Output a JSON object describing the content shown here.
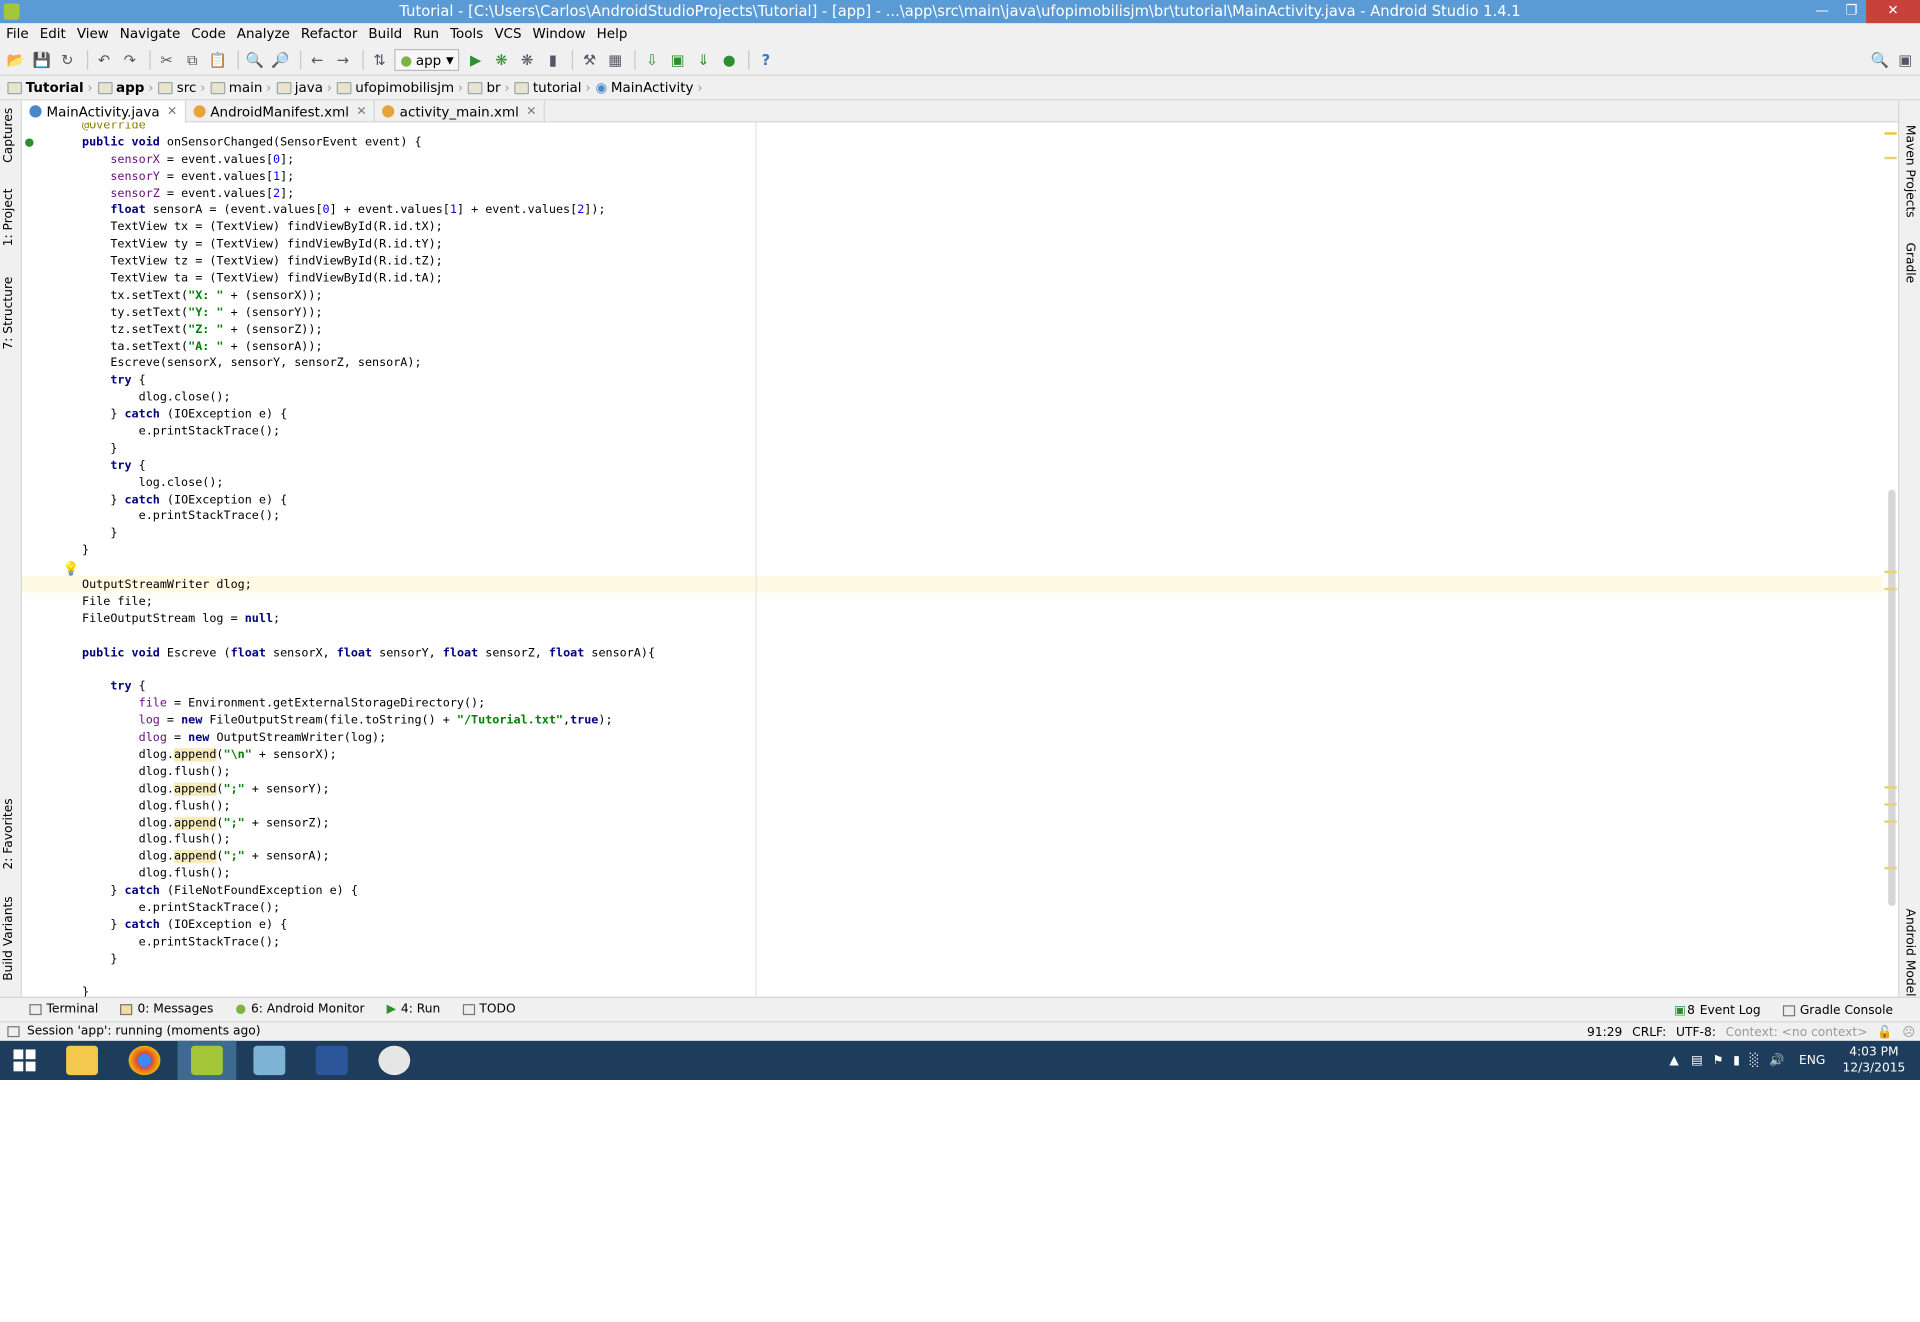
{
  "window": {
    "title": "Tutorial - [C:\\Users\\Carlos\\AndroidStudioProjects\\Tutorial] - [app] - ...\\app\\src\\main\\java\\ufopimobilisjm\\br\\tutorial\\MainActivity.java - Android Studio 1.4.1"
  },
  "menu": [
    "File",
    "Edit",
    "View",
    "Navigate",
    "Code",
    "Analyze",
    "Refactor",
    "Build",
    "Run",
    "Tools",
    "VCS",
    "Window",
    "Help"
  ],
  "toolbar": {
    "run_config": "app"
  },
  "breadcrumb": [
    "Tutorial",
    "app",
    "src",
    "main",
    "java",
    "ufopimobilisjm",
    "br",
    "tutorial",
    "MainActivity"
  ],
  "tabs": [
    {
      "label": "MainActivity.java",
      "active": true
    },
    {
      "label": "AndroidManifest.xml",
      "active": false
    },
    {
      "label": "activity_main.xml",
      "active": false
    }
  ],
  "left_panels": [
    "Captures",
    "1: Project",
    "7: Structure",
    "2: Favorites",
    "Build Variants"
  ],
  "right_panels": [
    "Maven Projects",
    "Gradle",
    "Android Model"
  ],
  "bottom_tools": [
    {
      "label": "Terminal"
    },
    {
      "label": "0: Messages"
    },
    {
      "label": "6: Android Monitor"
    },
    {
      "label": "4: Run"
    },
    {
      "label": "TODO"
    }
  ],
  "bottom_right_tools": [
    "Event Log",
    "Gradle Console"
  ],
  "event_log_count": "8",
  "status": {
    "message": "Session 'app': running (moments ago)",
    "position": "91:29",
    "line_sep": "CRLF:",
    "encoding": "UTF-8:",
    "context": "Context: <no context>"
  },
  "taskbar": {
    "lang": "ENG",
    "time": "4:03 PM",
    "date": "12/3/2015"
  },
  "code_lines": [
    "@Override",
    "public void onSensorChanged(SensorEvent event) {",
    "    sensorX = event.values[0];",
    "    sensorY = event.values[1];",
    "    sensorZ = event.values[2];",
    "    float sensorA = (event.values[0] + event.values[1] + event.values[2]);",
    "    TextView tx = (TextView) findViewById(R.id.tX);",
    "    TextView ty = (TextView) findViewById(R.id.tY);",
    "    TextView tz = (TextView) findViewById(R.id.tZ);",
    "    TextView ta = (TextView) findViewById(R.id.tA);",
    "    tx.setText(\"X: \" + (sensorX));",
    "    ty.setText(\"Y: \" + (sensorY));",
    "    tz.setText(\"Z: \" + (sensorZ));",
    "    ta.setText(\"A: \" + (sensorA));",
    "    Escreve(sensorX, sensorY, sensorZ, sensorA);",
    "    try {",
    "        dlog.close();",
    "    } catch (IOException e) {",
    "        e.printStackTrace();",
    "    }",
    "    try {",
    "        log.close();",
    "    } catch (IOException e) {",
    "        e.printStackTrace();",
    "    }",
    "}",
    "",
    "OutputStreamWriter dlog;",
    "File file;",
    "FileOutputStream log = null;",
    "",
    "public void Escreve (float sensorX, float sensorY, float sensorZ, float sensorA){",
    "",
    "    try {",
    "        file = Environment.getExternalStorageDirectory();",
    "        log = new FileOutputStream(file.toString() + \"/Tutorial.txt\",true);",
    "        dlog = new OutputStreamWriter(log);",
    "        dlog.append(\"\\n\" + sensorX);",
    "        dlog.flush();",
    "        dlog.append(\";\" + sensorY);",
    "        dlog.flush();",
    "        dlog.append(\";\" + sensorZ);",
    "        dlog.flush();",
    "        dlog.append(\";\" + sensorA);",
    "        dlog.flush();",
    "    } catch (FileNotFoundException e) {",
    "        e.printStackTrace();",
    "    } catch (IOException e) {",
    "        e.printStackTrace();",
    "    }",
    "",
    "}"
  ]
}
